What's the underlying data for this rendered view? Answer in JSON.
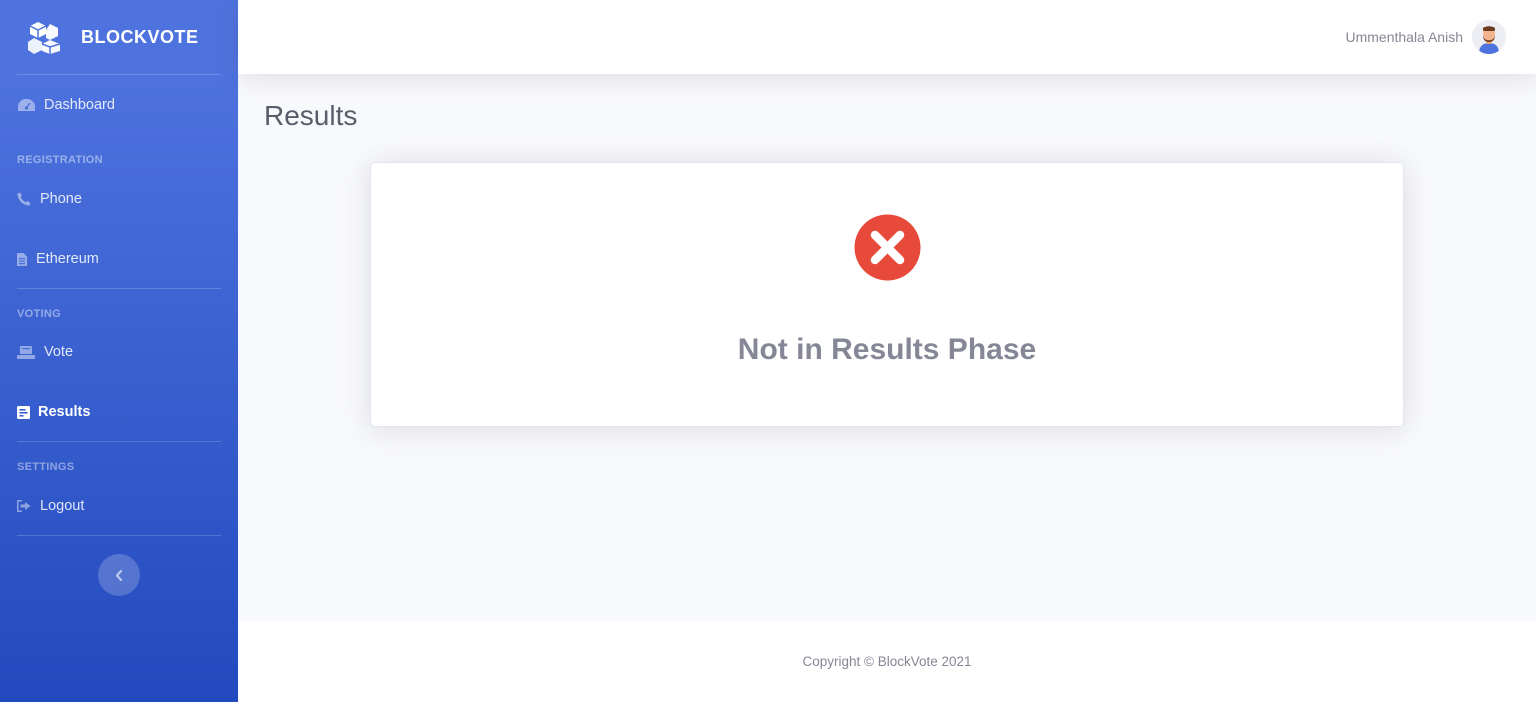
{
  "brand": {
    "name": "BLOCKVOTE",
    "icon": "cubes-icon"
  },
  "sidebar": {
    "dashboard": {
      "label": "Dashboard",
      "icon": "tachometer-icon"
    },
    "headings": {
      "registration": "REGISTRATION",
      "voting": "VOTING",
      "settings": "SETTINGS"
    },
    "phone": {
      "label": "Phone",
      "icon": "phone-icon"
    },
    "ethereum": {
      "label": "Ethereum",
      "icon": "file-icon"
    },
    "vote": {
      "label": "Vote",
      "icon": "vote-box-icon"
    },
    "results": {
      "label": "Results",
      "icon": "poll-icon",
      "active": true
    },
    "logout": {
      "label": "Logout",
      "icon": "sign-out-icon"
    },
    "toggle_icon": "chevron-left-icon"
  },
  "topbar": {
    "user_name": "Ummenthala Anish",
    "avatar_icon": "user-avatar"
  },
  "main": {
    "title": "Results",
    "status": {
      "icon": "times-circle-icon",
      "message": "Not in Results Phase"
    }
  },
  "footer": {
    "copyright": "Copyright © BlockVote 2021"
  },
  "colors": {
    "sidebar_top": "#4e73df",
    "sidebar_bottom": "#224abe",
    "error": "#e74a3b",
    "text_muted": "#858796",
    "page_bg": "#f8f9fc"
  }
}
